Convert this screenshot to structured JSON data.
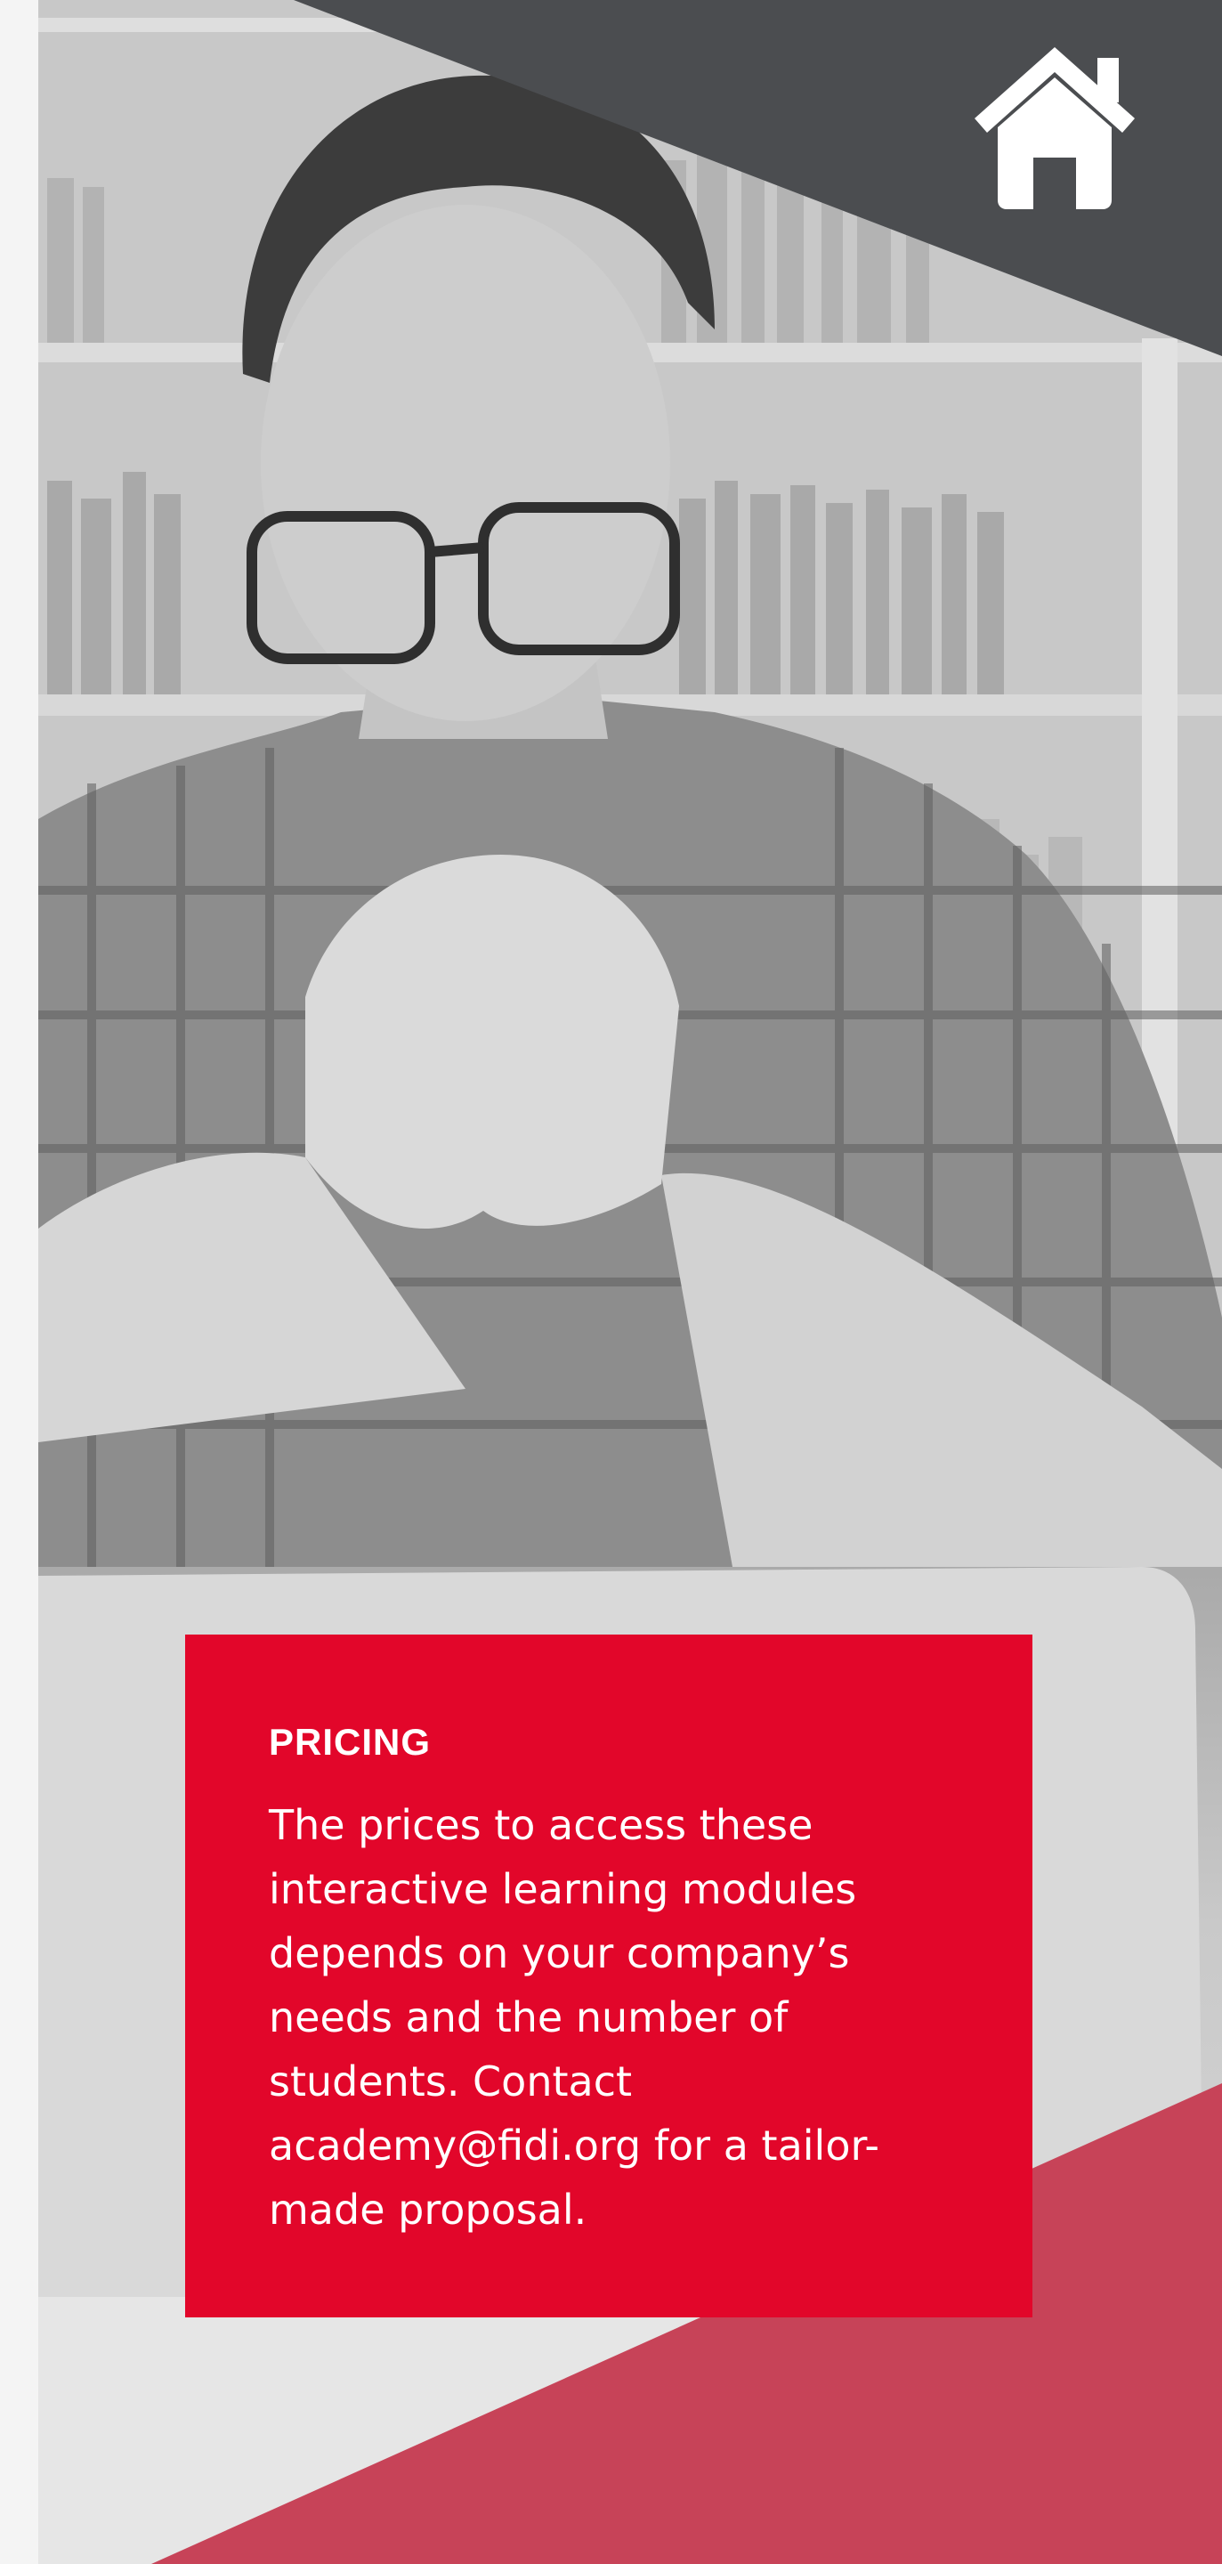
{
  "colors": {
    "accent_red": "#e2062a",
    "accent_red_soft": "#c74358",
    "dark_banner": "#4b4d50",
    "icon_white": "#ffffff"
  },
  "header": {
    "home_icon": "home-icon"
  },
  "photo": {
    "subject": "photo-man-with-laptop"
  },
  "pricing": {
    "title": "PRICING",
    "body": "The prices to access these interactive learning modules depends on your company’s needs and the number of students. Contact academy@fidi.org for a tailor-made proposal."
  }
}
